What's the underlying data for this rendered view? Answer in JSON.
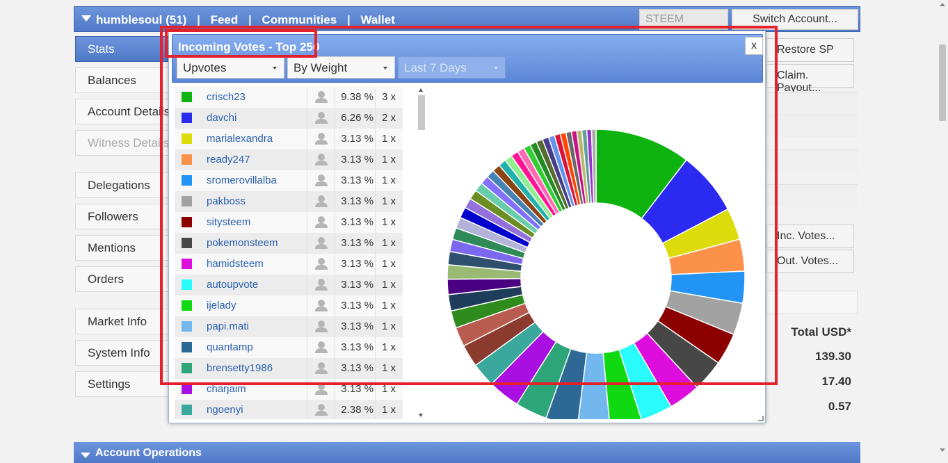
{
  "topbar": {
    "nav": [
      "humblesoul (51)",
      "|",
      "Feed",
      "|",
      "Communities",
      "|",
      "Wallet"
    ],
    "currency": "STEEM",
    "switch_account": "Switch Account..."
  },
  "sidebar": {
    "items": [
      {
        "label": "Stats",
        "state": "active"
      },
      {
        "label": "Balances",
        "state": "normal"
      },
      {
        "label": "Account Details",
        "state": "normal"
      },
      {
        "label": "Witness Details",
        "state": "disabled"
      },
      {
        "label": "Delegations",
        "state": "normal"
      },
      {
        "label": "Followers",
        "state": "normal"
      },
      {
        "label": "Mentions",
        "state": "normal"
      },
      {
        "label": "Orders",
        "state": "normal"
      },
      {
        "label": "Market Info",
        "state": "normal"
      },
      {
        "label": "System Info",
        "state": "normal"
      },
      {
        "label": "Settings",
        "state": "normal"
      }
    ]
  },
  "right": {
    "restore_sp": "Restore SP",
    "claim_payout": "Claim. Payout...",
    "inc_votes": "Inc. Votes...",
    "out_votes": "Out. Votes...",
    "total_usd_header": "Total USD*",
    "values": [
      "139.30",
      "17.40",
      "0.57"
    ]
  },
  "bottom": {
    "title": "Account Operations"
  },
  "modal": {
    "title": "Incoming Votes - Top 250",
    "close": "x",
    "filters": {
      "type": "Upvotes",
      "sort": "By Weight",
      "period": "Last 7 Days"
    },
    "voters": [
      {
        "name": "crisch23",
        "pct": "9.38 %",
        "count": "3 x",
        "color": "#0fb30f"
      },
      {
        "name": "davchi",
        "pct": "6.26 %",
        "count": "2 x",
        "color": "#2a2af0"
      },
      {
        "name": "marialexandra",
        "pct": "3.13 %",
        "count": "1 x",
        "color": "#dcdc0c"
      },
      {
        "name": "ready247",
        "pct": "3.13 %",
        "count": "1 x",
        "color": "#fc914a"
      },
      {
        "name": "sromerovillalba",
        "pct": "3.13 %",
        "count": "1 x",
        "color": "#2294f5"
      },
      {
        "name": "pakboss",
        "pct": "3.13 %",
        "count": "1 x",
        "color": "#a2a2a2"
      },
      {
        "name": "sitysteem",
        "pct": "3.13 %",
        "count": "1 x",
        "color": "#8c0000"
      },
      {
        "name": "pokemonsteem",
        "pct": "3.13 %",
        "count": "1 x",
        "color": "#474747"
      },
      {
        "name": "hamidsteem",
        "pct": "3.13 %",
        "count": "1 x",
        "color": "#dd0ddd"
      },
      {
        "name": "autoupvote",
        "pct": "3.13 %",
        "count": "1 x",
        "color": "#2afcfc"
      },
      {
        "name": "ijelady",
        "pct": "3.13 %",
        "count": "1 x",
        "color": "#11d911"
      },
      {
        "name": "papi.mati",
        "pct": "3.13 %",
        "count": "1 x",
        "color": "#73b7ef"
      },
      {
        "name": "quantamp",
        "pct": "3.13 %",
        "count": "1 x",
        "color": "#2e6996"
      },
      {
        "name": "brensetty1986",
        "pct": "3.13 %",
        "count": "1 x",
        "color": "#2ea578"
      },
      {
        "name": "charjaim",
        "pct": "3.13 %",
        "count": "1 x",
        "color": "#a80fe0"
      },
      {
        "name": "ngoenyi",
        "pct": "2.38 %",
        "count": "1 x",
        "color": "#3ba89e"
      }
    ]
  },
  "chart_data": {
    "type": "pie",
    "title": "",
    "labels": [
      "crisch23",
      "davchi",
      "marialexandra",
      "ready247",
      "sromerovillalba",
      "pakboss",
      "sitysteem",
      "pokemonsteem",
      "hamidsteem",
      "autoupvote",
      "ijelady",
      "papi.mati",
      "quantamp",
      "brensetty1986",
      "charjaim",
      "ngoenyi"
    ],
    "values": [
      9.38,
      6.26,
      3.13,
      3.13,
      3.13,
      3.13,
      3.13,
      3.13,
      3.13,
      3.13,
      3.13,
      3.13,
      3.13,
      3.13,
      3.13,
      2.38
    ],
    "colors": [
      "#0fb30f",
      "#2a2af0",
      "#dcdc0c",
      "#fc914a",
      "#2294f5",
      "#a2a2a2",
      "#8c0000",
      "#474747",
      "#dd0ddd",
      "#2afcfc",
      "#11d911",
      "#73b7ef",
      "#2e6996",
      "#2ea578",
      "#a80fe0",
      "#3ba89e"
    ],
    "other_values": [
      2.2,
      1.9,
      1.7,
      1.6,
      1.5,
      1.4,
      1.3,
      1.2,
      1.15,
      1.1,
      1.05,
      1.0,
      0.95,
      0.9,
      0.85,
      0.8,
      0.78,
      0.76,
      0.74,
      0.72,
      0.7,
      0.68,
      0.66,
      0.64,
      0.62,
      0.6,
      0.58,
      0.56,
      0.54,
      0.52,
      0.5,
      0.48,
      0.46,
      0.44
    ],
    "other_colors": [
      "#8b3a2e",
      "#b85c50",
      "#2e8b1c",
      "#1d3d5a",
      "#4b0082",
      "#9ab973",
      "#2f4f6f",
      "#7b68ee",
      "#2e8b57",
      "#b3b3d9",
      "#0000cd",
      "#9370db",
      "#6b8e23",
      "#66cdaa",
      "#8470ff",
      "#4682b4",
      "#8b4513",
      "#20b2aa",
      "#90ee90",
      "#ff1493",
      "#ff69b4",
      "#32cd32",
      "#228b22",
      "#556b2f",
      "#483d8b",
      "#6495ed",
      "#dc143c",
      "#ff4500",
      "#696969",
      "#c71585",
      "#bdb76b",
      "#5f9ea0",
      "#9932cc",
      "#a9a9a9"
    ]
  }
}
